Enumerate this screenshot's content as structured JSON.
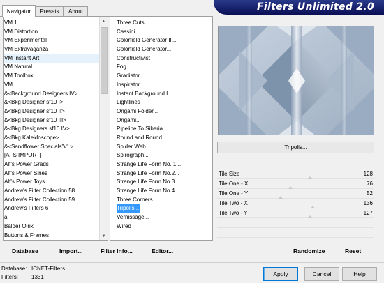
{
  "tabs": [
    "Navigator",
    "Presets",
    "About"
  ],
  "title": "Filters Unlimited 2.0",
  "categories": [
    "VM 1",
    "VM Distortion",
    "VM Experimental",
    "VM Extravaganza",
    "VM Instant Art",
    "VM Natural",
    "VM Toolbox",
    "VM",
    "&<Background Designers IV>",
    "&<Bkg Designer sf10 I>",
    "&<Bkg Designer sf10 II>",
    "&<Bkg Designer sf10 III>",
    "&<Bkg Designers sf10 IV>",
    "&<Bkg Kaleidoscope>",
    "&<Sandflower Specials\"v\" >",
    "[AFS IMPORT]",
    "Alf's Power Grads",
    "Alf's Power Sines",
    "Alf's Power Toys",
    "Andrew's Filter Collection 58",
    "Andrew's Filter Collection 59",
    "Andrew's Filters 6",
    "a",
    "Balder Olrik",
    "Buttons & Frames"
  ],
  "selected_category": "VM Instant Art",
  "filters": [
    "Three Cuts",
    "Cassini...",
    "Colorfield Generator II...",
    "Colorfield Generator...",
    "Constructivist",
    "Fog...",
    "Gradiator...",
    "Inspirator...",
    "Instant Background I...",
    "Lightlines",
    "Origami Folder...",
    "Origami...",
    "Pipeline To Siberia",
    "Round and Round...",
    "Spider Web...",
    "Spirograph...",
    "Strange Life Form No. 1...",
    "Strange Life Form No.2...",
    "Strange Life Form No.3...",
    "Strange Life Form No.4...",
    "Three Corners",
    "Tripolis...",
    "Vernissage...",
    "Wired"
  ],
  "selected_filter": "Tripolis...",
  "filter_button": "Tripolis...",
  "parameters": [
    {
      "name": "Tile Size",
      "value": "128",
      "level": 0.5
    },
    {
      "name": "Tile One - X",
      "value": "76",
      "level": 0.3
    },
    {
      "name": "Tile One - Y",
      "value": "52",
      "level": 0.2
    },
    {
      "name": "Tile Two - X",
      "value": "136",
      "level": 0.53
    },
    {
      "name": "Tile Two - Y",
      "value": "127",
      "level": 0.5
    }
  ],
  "bottom_links": {
    "database": "Database",
    "import": "Import...",
    "filter_info": "Filter Info...",
    "editor": "Editor...",
    "randomize": "Randomize",
    "reset": "Reset"
  },
  "status": {
    "database_label": "Database:",
    "database_value": "ICNET-Filters",
    "filters_label": "Filters:",
    "filters_value": "1331"
  },
  "buttons": {
    "apply": "Apply",
    "cancel": "Cancel",
    "help": "Help"
  },
  "colors": {
    "selection": "#3399ff",
    "banner": "#0a0f55",
    "preview_light": "#c4cfdd",
    "preview_dark": "#7a8fa8"
  }
}
